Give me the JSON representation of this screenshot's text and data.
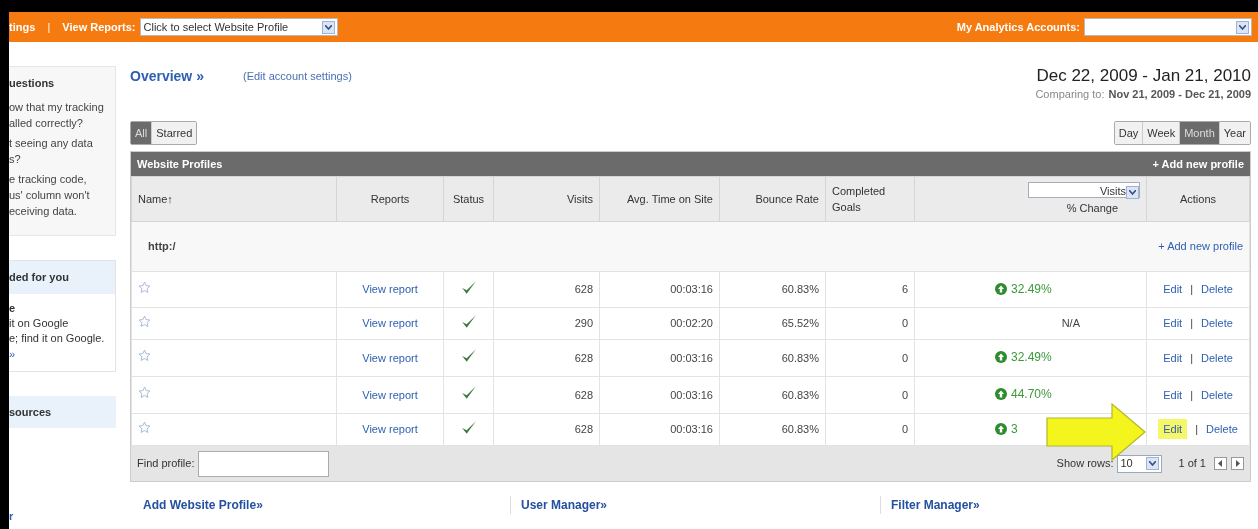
{
  "top_bar": {
    "settings_link": "tings",
    "separator": "|",
    "view_reports_label": "View Reports:",
    "profile_select": "Click to select Website Profile",
    "accounts_label": "My Analytics Accounts:"
  },
  "sidebar": {
    "help": {
      "title": "uestions",
      "questions": [
        {
          "lines": [
            "ow that my tracking",
            "alled correctly?"
          ]
        },
        {
          "lines": [
            "t seeing any data",
            "s?"
          ]
        },
        {
          "lines": [
            "e tracking code,",
            "us' column won't",
            "eceiving data."
          ]
        }
      ]
    },
    "recommended": {
      "title": "ded for you",
      "heading": "e",
      "lines": [
        "it on Google",
        "e; find it on Google."
      ],
      "more_link": "»"
    },
    "resources": {
      "title": "sources"
    },
    "footer_link": "r"
  },
  "header": {
    "title": "Overview »",
    "edit_link": "(Edit account settings)",
    "date_range": "Dec 22, 2009 - Jan 21, 2010",
    "comparing_label": "Comparing to:",
    "comparing_range": "Nov 21, 2009 - Dec 21, 2009"
  },
  "filter_tabs": [
    {
      "label": "All",
      "selected": true
    },
    {
      "label": "Starred",
      "selected": false
    }
  ],
  "period_tabs": [
    {
      "label": "Day",
      "selected": false
    },
    {
      "label": "Week",
      "selected": false
    },
    {
      "label": "Month",
      "selected": true
    },
    {
      "label": "Year",
      "selected": false
    }
  ],
  "table": {
    "title": "Website Profiles",
    "add_link": "+ Add new profile",
    "columns": [
      "Name↑",
      "Reports",
      "Status",
      "Visits",
      "Avg. Time on Site",
      "Bounce Rate",
      "Completed Goals",
      "% Change",
      "Actions"
    ],
    "metric_select": "Visits",
    "account_row": {
      "name": "http:/",
      "add_link": "+ Add new profile"
    },
    "rows": [
      {
        "starred": false,
        "report": "View report",
        "tracking_ok": true,
        "visits": "628",
        "avg_time": "00:03:16",
        "bounce_rate": "60.83%",
        "goals": "6",
        "change": "32.49%",
        "rising": true,
        "edit": "Edit",
        "separator": "|",
        "delete": "Delete",
        "highlighted": false
      },
      {
        "starred": false,
        "report": "View report",
        "tracking_ok": true,
        "visits": "290",
        "avg_time": "00:02:20",
        "bounce_rate": "65.52%",
        "goals": "0",
        "change": "N/A",
        "rising": false,
        "edit": "Edit",
        "separator": "|",
        "delete": "Delete",
        "highlighted": false
      },
      {
        "starred": false,
        "report": "View report",
        "tracking_ok": true,
        "visits": "628",
        "avg_time": "00:03:16",
        "bounce_rate": "60.83%",
        "goals": "0",
        "change": "32.49%",
        "rising": true,
        "edit": "Edit",
        "separator": "|",
        "delete": "Delete",
        "highlighted": false
      },
      {
        "starred": false,
        "report": "View report",
        "tracking_ok": true,
        "visits": "628",
        "avg_time": "00:03:16",
        "bounce_rate": "60.83%",
        "goals": "0",
        "change": "44.70%",
        "rising": true,
        "edit": "Edit",
        "separator": "|",
        "delete": "Delete",
        "highlighted": false
      },
      {
        "starred": false,
        "report": "View report",
        "tracking_ok": true,
        "visits": "628",
        "avg_time": "00:03:16",
        "bounce_rate": "60.83%",
        "goals": "0",
        "change": "3",
        "rising": true,
        "edit": "Edit",
        "separator": "|",
        "delete": "Delete",
        "highlighted": true
      }
    ],
    "footer": {
      "find_label": "Find profile:",
      "show_rows_label": "Show rows:",
      "rows_select": "10",
      "pager": "1 of 1"
    }
  },
  "bottom_links": [
    "Add Website Profile»",
    "User Manager»",
    "Filter Manager»"
  ]
}
